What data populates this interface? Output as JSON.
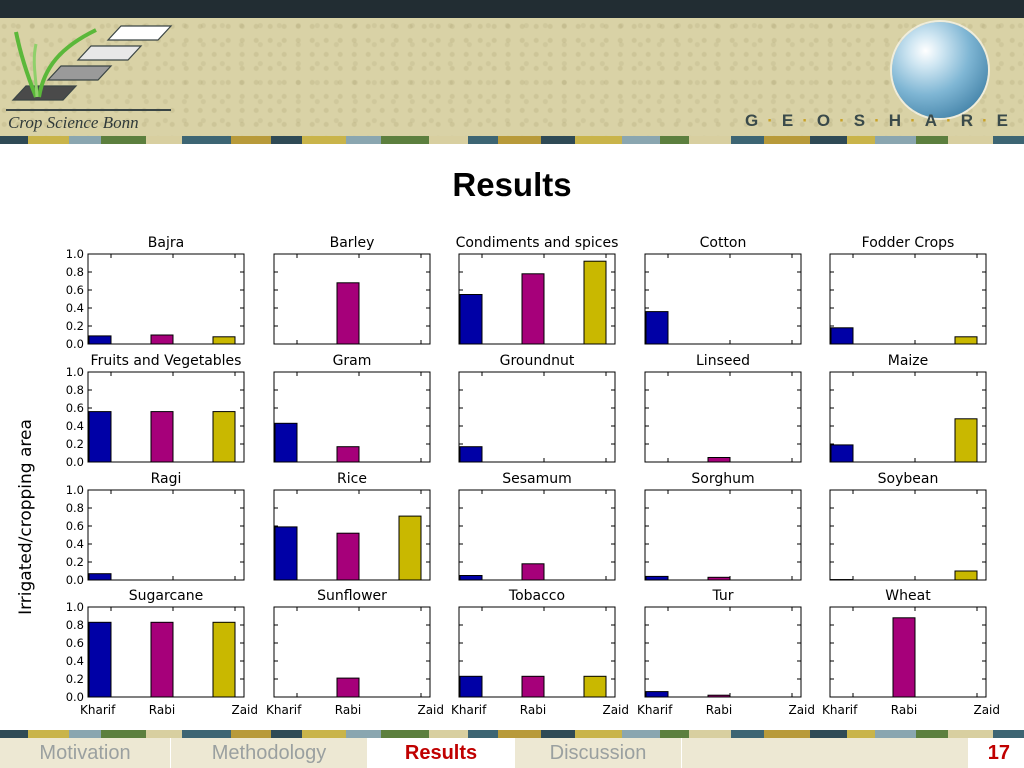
{
  "header": {
    "brand_name": "Crop Science Bonn",
    "project_letters": [
      "G",
      "E",
      "O",
      "S",
      "H",
      "A",
      "R",
      "E"
    ]
  },
  "slide": {
    "title": "Results"
  },
  "footer": {
    "nav": [
      "Motivation",
      "Methodology",
      "Results",
      "Discussion"
    ],
    "active": "Results",
    "page_number": "17"
  },
  "colors": {
    "kharif": "#0000a6",
    "rabi": "#a6007a",
    "zaid": "#c9b800",
    "accent_red": "#c00000"
  },
  "chart_data": {
    "type": "bar",
    "ylabel": "Irrigated/cropping area",
    "categories": [
      "Kharif",
      "Rabi",
      "Zaid"
    ],
    "ylim": [
      0,
      1.0
    ],
    "yticks": [
      "0.0",
      "0.2",
      "0.4",
      "0.6",
      "0.8",
      "1.0"
    ],
    "panels": [
      {
        "title": "Bajra",
        "values": [
          0.09,
          0.1,
          0.08
        ]
      },
      {
        "title": "Barley",
        "values": [
          null,
          0.68,
          null
        ]
      },
      {
        "title": "Condiments and spices",
        "values": [
          0.55,
          0.78,
          0.92
        ]
      },
      {
        "title": "Cotton",
        "values": [
          0.36,
          null,
          null
        ]
      },
      {
        "title": "Fodder Crops",
        "values": [
          0.18,
          null,
          0.08
        ]
      },
      {
        "title": "Fruits and Vegetables",
        "values": [
          0.56,
          0.56,
          0.56
        ]
      },
      {
        "title": "Gram",
        "values": [
          0.43,
          0.17,
          null
        ]
      },
      {
        "title": "Groundnut",
        "values": [
          0.17,
          null,
          null
        ]
      },
      {
        "title": "Linseed",
        "values": [
          null,
          0.05,
          null
        ]
      },
      {
        "title": "Maize",
        "values": [
          0.19,
          null,
          0.48
        ]
      },
      {
        "title": "Ragi",
        "values": [
          0.07,
          null,
          null
        ]
      },
      {
        "title": "Rice",
        "values": [
          0.59,
          0.52,
          0.71
        ]
      },
      {
        "title": "Sesamum",
        "values": [
          0.05,
          0.18,
          null
        ]
      },
      {
        "title": "Sorghum",
        "values": [
          0.04,
          0.03,
          null
        ]
      },
      {
        "title": "Soybean",
        "values": [
          0.005,
          null,
          0.1
        ]
      },
      {
        "title": "Sugarcane",
        "values": [
          0.83,
          0.83,
          0.83
        ]
      },
      {
        "title": "Sunflower",
        "values": [
          null,
          0.21,
          null
        ]
      },
      {
        "title": "Tobacco",
        "values": [
          0.23,
          0.23,
          0.23
        ]
      },
      {
        "title": "Tur",
        "values": [
          0.06,
          0.02,
          null
        ]
      },
      {
        "title": "Wheat",
        "values": [
          null,
          0.88,
          null
        ]
      }
    ]
  }
}
